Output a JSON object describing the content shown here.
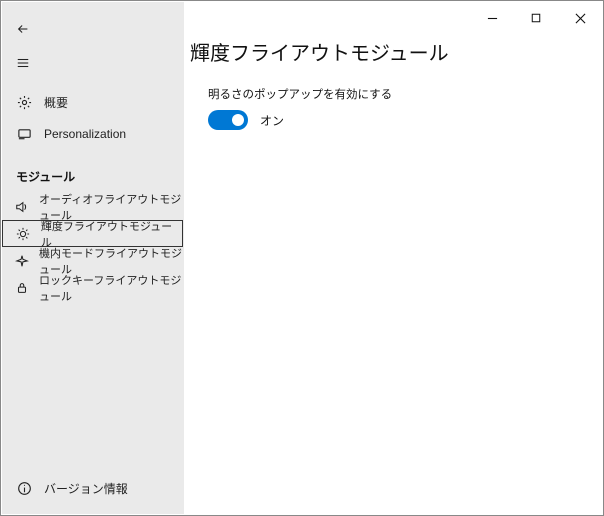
{
  "window": {
    "minimize": "minimize",
    "maximize": "maximize",
    "close": "close"
  },
  "sidebar": {
    "nav": {
      "overview_label": "概要",
      "personalization_label": "Personalization"
    },
    "section_header": "モジュール",
    "modules": [
      {
        "label": "オーディオフライアウトモジュール"
      },
      {
        "label": "輝度フライアウトモジュール"
      },
      {
        "label": "機内モードフライアウトモジュール"
      },
      {
        "label": "ロックキーフライアウトモジュール"
      }
    ],
    "about_label": "バージョン情報"
  },
  "content": {
    "title": "輝度フライアウトモジュール",
    "setting": {
      "label": "明るさのポップアップを有効にする",
      "value_text": "オン",
      "value_on": true
    }
  }
}
